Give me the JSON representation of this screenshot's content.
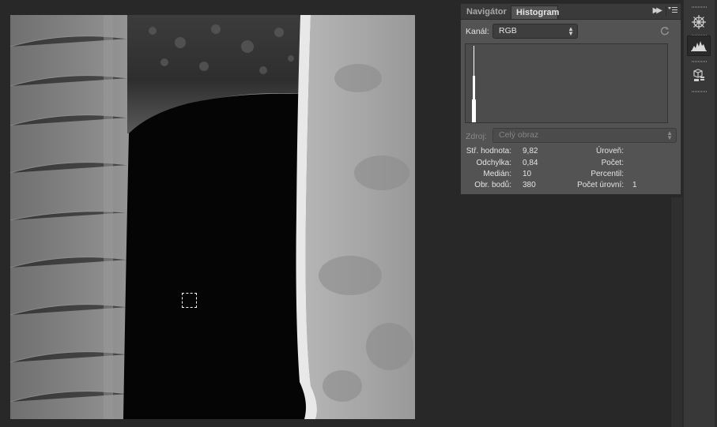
{
  "panel": {
    "tabs": [
      {
        "label": "Navigátor",
        "active": false
      },
      {
        "label": "Histogram",
        "active": true
      }
    ],
    "channel": {
      "label": "Kanál:",
      "value": "RGB"
    },
    "source": {
      "label": "Zdroj:",
      "value": "Celý obraz"
    },
    "stats_left": [
      {
        "label": "Stř. hodnota:",
        "value": "9,82"
      },
      {
        "label": "Odchylka:",
        "value": "0,84"
      },
      {
        "label": "Medián:",
        "value": "10"
      },
      {
        "label": "Obr. bodů:",
        "value": "380"
      }
    ],
    "stats_right": [
      {
        "label": "Úroveň:",
        "value": ""
      },
      {
        "label": "Počet:",
        "value": ""
      },
      {
        "label": "Percentil:",
        "value": ""
      },
      {
        "label": "Počet úrovní:",
        "value": "1"
      }
    ]
  },
  "dock": {
    "buttons": [
      {
        "icon": "navigator-wheel-icon",
        "active": false
      },
      {
        "icon": "histogram-icon",
        "active": true
      },
      {
        "icon": "properties-cube-icon",
        "active": false
      }
    ]
  },
  "icons": {
    "expand": "double-chevron-right-icon",
    "menu": "panel-menu-icon",
    "refresh": "refresh-icon"
  },
  "colors": {
    "panel_bg": "#535353",
    "app_bg": "#282828",
    "graph_bg": "#4c4c4c"
  }
}
